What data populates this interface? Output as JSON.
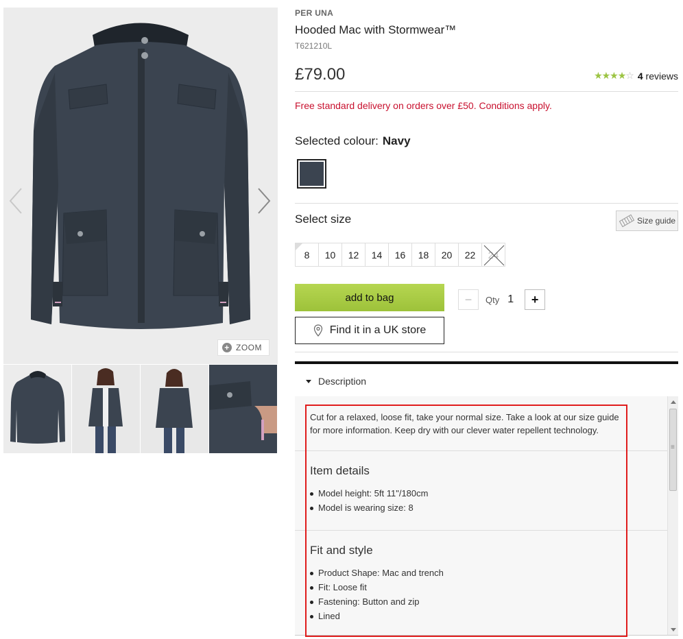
{
  "gallery": {
    "zoom_label": "ZOOM",
    "thumbnails": [
      "jacket-front",
      "model-front",
      "model-back",
      "pocket-detail"
    ]
  },
  "product": {
    "brand": "PER UNA",
    "title": "Hooded Mac with Stormwear™",
    "sku": "T621210L",
    "price": "£79.00",
    "rating": {
      "stars": 4,
      "max": 5,
      "count": "4",
      "label": "reviews"
    },
    "delivery_note": "Free standard delivery on orders over £50. Conditions apply."
  },
  "colour": {
    "label": "Selected colour:",
    "value": "Navy",
    "swatch_color": "#3b4450"
  },
  "size": {
    "label": "Select size",
    "guide_label": "Size guide",
    "options": [
      {
        "label": "8",
        "available": true
      },
      {
        "label": "10",
        "available": true
      },
      {
        "label": "12",
        "available": true
      },
      {
        "label": "14",
        "available": true
      },
      {
        "label": "16",
        "available": true
      },
      {
        "label": "18",
        "available": true
      },
      {
        "label": "20",
        "available": true
      },
      {
        "label": "22",
        "available": true
      },
      {
        "label": "24",
        "available": false
      }
    ]
  },
  "actions": {
    "add_to_bag": "add to bag",
    "find_in_store": "Find it in a UK store",
    "qty_label": "Qty",
    "qty_value": "1",
    "minus": "−",
    "plus": "+"
  },
  "description": {
    "heading": "Description",
    "intro": "Cut for a relaxed, loose fit, take your normal size. Take a look at our size guide for more information. Keep dry with our clever water repellent technology.",
    "item_details": {
      "title": "Item details",
      "items": [
        "Model height: 5ft 11\"/180cm",
        "Model is wearing size: 8"
      ]
    },
    "fit_style": {
      "title": "Fit and style",
      "items": [
        "Product Shape: Mac and trench",
        "Fit: Loose fit",
        "Fastening: Button and zip",
        "Lined"
      ]
    }
  },
  "colors": {
    "accent_green": "#a5c93d",
    "delivery_red": "#c8102e",
    "highlight_red": "#e01b1b"
  }
}
